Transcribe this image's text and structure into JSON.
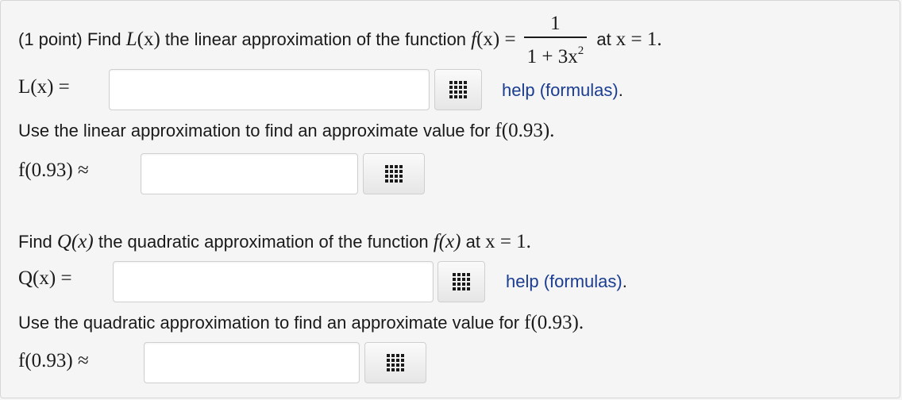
{
  "q1": {
    "lead": "(1 point) Find ",
    "L_name": "L",
    "L_arg": "(x)",
    "mid": " the linear approximation of the function ",
    "f_name": "f",
    "f_arg": "(x) =",
    "frac_num": "1",
    "frac_den": "1 + 3x",
    "frac_exp": "2",
    "at": " at ",
    "x_eq": "x = 1."
  },
  "row_L": {
    "label": "L(x) =",
    "input_value": "",
    "help": "help (formulas)",
    "help_dot": "."
  },
  "p_linear": {
    "text": "Use the linear approximation to find an approximate value for ",
    "f_val": "f(0.93)."
  },
  "row_f1": {
    "label": "f(0.93) ≈",
    "input_value": ""
  },
  "q2": {
    "lead": "Find ",
    "Q_name": "Q(x)",
    "mid": " the quadratic approximation of the function ",
    "f_expr": "f(x)",
    "at": " at ",
    "x_eq": "x = 1."
  },
  "row_Q": {
    "label": "Q(x) =",
    "input_value": "",
    "help": "help (formulas)",
    "help_dot": "."
  },
  "p_quad": {
    "text": "Use the quadratic approximation to find an approximate value for ",
    "f_val": "f(0.93)."
  },
  "row_f2": {
    "label": "f(0.93) ≈",
    "input_value": ""
  },
  "icons": {
    "palette": "equation-editor-grid-icon"
  },
  "colors": {
    "link": "#1b3d91",
    "background": "#f5f5f5",
    "input_bg": "#ffffff"
  }
}
